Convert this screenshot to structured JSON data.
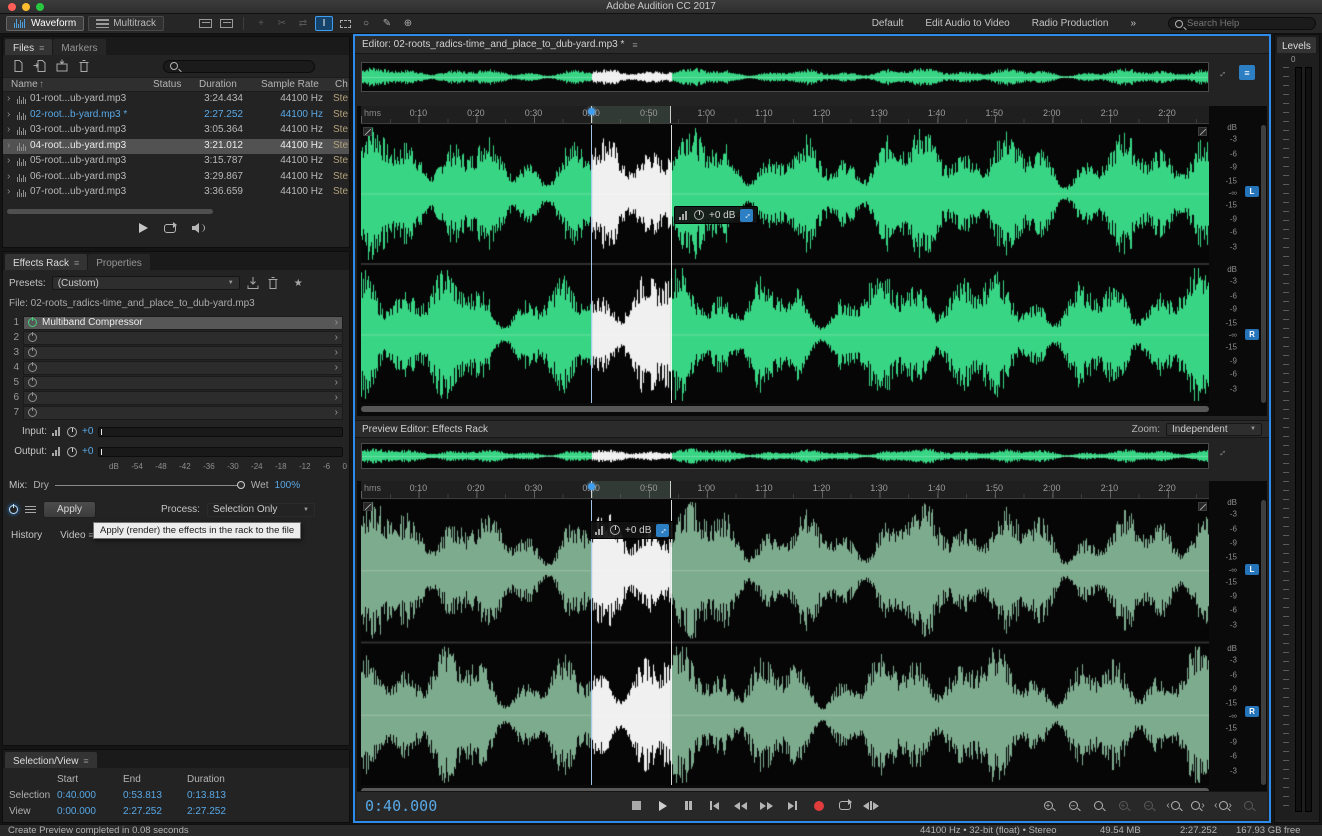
{
  "titlebar": {
    "title": "Adobe Audition CC 2017"
  },
  "toolbar": {
    "waveform_label": "Waveform",
    "multitrack_label": "Multitrack",
    "workspaces": [
      "Default",
      "Edit Audio to Video",
      "Radio Production"
    ],
    "overflow_label": "»",
    "search_placeholder": "Search Help"
  },
  "icons": {
    "panel_menu": "≡",
    "chevron_right": "›",
    "sort_asc": "↑",
    "dropdown_arrow": "▼",
    "star": "★"
  },
  "files": {
    "tab_files": "Files",
    "tab_markers": "Markers",
    "col_name": "Name",
    "col_status": "Status",
    "col_duration": "Duration",
    "col_sample_rate": "Sample Rate",
    "col_channels": "Ch",
    "rows": [
      {
        "name": "01-root...ub-yard.mp3",
        "duration": "3:24.434",
        "sample_rate": "44100 Hz",
        "channels": "Ste"
      },
      {
        "name": "02-root...b-yard.mp3 *",
        "duration": "2:27.252",
        "sample_rate": "44100 Hz",
        "channels": "Ste"
      },
      {
        "name": "03-root...ub-yard.mp3",
        "duration": "3:05.364",
        "sample_rate": "44100 Hz",
        "channels": "Ste"
      },
      {
        "name": "04-root...ub-yard.mp3",
        "duration": "3:21.012",
        "sample_rate": "44100 Hz",
        "channels": "Ste"
      },
      {
        "name": "05-root...ub-yard.mp3",
        "duration": "3:15.787",
        "sample_rate": "44100 Hz",
        "channels": "Ste"
      },
      {
        "name": "06-root...ub-yard.mp3",
        "duration": "3:29.867",
        "sample_rate": "44100 Hz",
        "channels": "Ste"
      },
      {
        "name": "07-root...ub-yard.mp3",
        "duration": "3:36.659",
        "sample_rate": "44100 Hz",
        "channels": "Ste"
      }
    ]
  },
  "effects": {
    "tab_rack": "Effects Rack",
    "tab_properties": "Properties",
    "presets_label": "Presets:",
    "preset_value": "(Custom)",
    "file_label": "File: 02-roots_radics-time_and_place_to_dub-yard.mp3",
    "slots": [
      {
        "num": "1",
        "name": "Multiband Compressor"
      },
      {
        "num": "2",
        "name": ""
      },
      {
        "num": "3",
        "name": ""
      },
      {
        "num": "4",
        "name": ""
      },
      {
        "num": "5",
        "name": ""
      },
      {
        "num": "6",
        "name": ""
      },
      {
        "num": "7",
        "name": ""
      }
    ],
    "input_label": "Input:",
    "output_label": "Output:",
    "gain_value": "+0",
    "db_scale": [
      "dB",
      "-54",
      "-48",
      "-42",
      "-36",
      "-30",
      "-24",
      "-18",
      "-12",
      "-6",
      "0"
    ],
    "mix_label": "Mix:",
    "dry_label": "Dry",
    "wet_label": "Wet",
    "mix_value": "100%",
    "apply_label": "Apply",
    "process_label": "Process:",
    "process_value": "Selection Only",
    "history_tab": "History",
    "video_tab": "Video",
    "tooltip": "Apply (render) the effects in the rack to the file"
  },
  "selection_view": {
    "title": "Selection/View",
    "col_start": "Start",
    "col_end": "End",
    "col_duration": "Duration",
    "rows": [
      {
        "label": "Selection",
        "start": "0:40.000",
        "end": "0:53.813",
        "duration": "0:13.813"
      },
      {
        "label": "View",
        "start": "0:00.000",
        "end": "2:27.252",
        "duration": "2:27.252"
      }
    ]
  },
  "editor": {
    "title": "Editor: 02-roots_radics-time_and_place_to_dub-yard.mp3 *",
    "preview_title": "Preview Editor: Effects Rack",
    "zoom_label": "Zoom:",
    "zoom_value": "Independent",
    "ruler_unit": "hms",
    "ruler_labels": [
      "0:10",
      "0:20",
      "0:30",
      "0:40",
      "0:50",
      "1:00",
      "1:10",
      "1:20",
      "1:30",
      "1:40",
      "1:50",
      "2:00",
      "2:10",
      "2:20"
    ],
    "hud_gain": "+0 dB",
    "db_unit": "dB",
    "db_scale": [
      "-3",
      "-6",
      "-9",
      "-15",
      "-∞",
      "-15",
      "-9",
      "-6",
      "-3"
    ],
    "channel_left": "L",
    "channel_right": "R",
    "time_display": "0:40.000",
    "selection_seconds": [
      40.0,
      53.813
    ],
    "duration_seconds": 147.252
  },
  "levels": {
    "title": "Levels",
    "scale_top": "0"
  },
  "statusbar": {
    "message": "Create Preview completed in 0.08 seconds",
    "format": "44100 Hz • 32-bit (float) • Stereo",
    "size": "49.54 MB",
    "duration": "2:27.252",
    "free_space": "167.93 GB free"
  },
  "colors": {
    "accent": "#2d8ceb",
    "value_blue": "#58a8e6",
    "wave_green": "#38d584",
    "wave_dim": "#7dab8e",
    "selection_white": "#f0f0f0",
    "record_red": "#e03c3c"
  }
}
